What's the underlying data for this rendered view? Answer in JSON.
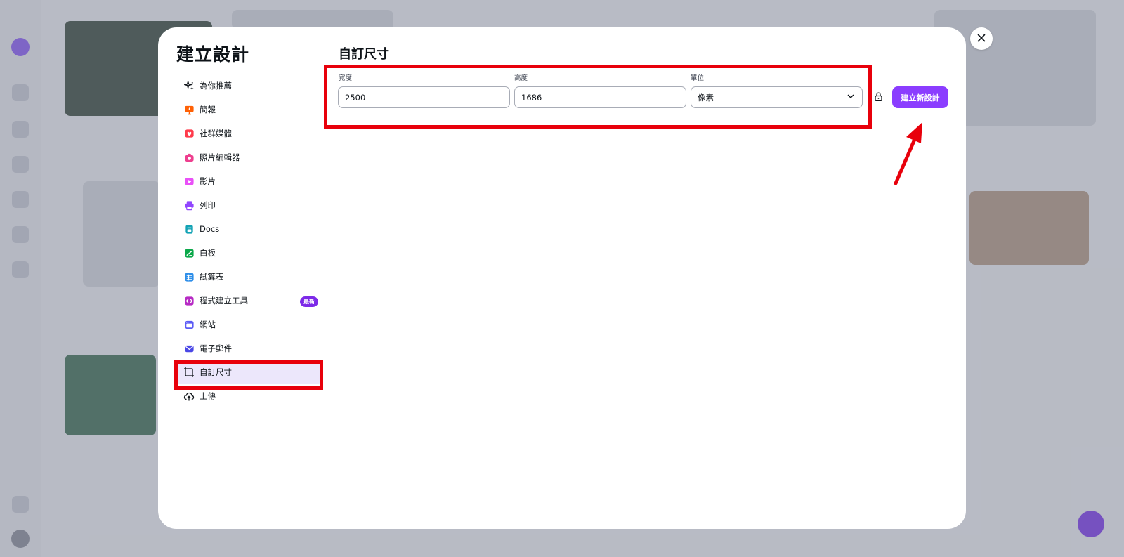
{
  "modal": {
    "title": "建立設計",
    "close_icon": "close-icon"
  },
  "menu": {
    "items": [
      {
        "label": "為你推薦",
        "icon": "sparkle-icon",
        "color": "#0e1318"
      },
      {
        "label": "簡報",
        "icon": "presentation-icon",
        "color": "#ff6105"
      },
      {
        "label": "社群媒體",
        "icon": "heart-icon",
        "color": "#ff3b4b"
      },
      {
        "label": "照片編輯器",
        "icon": "camera-icon",
        "color": "#ee3f8f"
      },
      {
        "label": "影片",
        "icon": "video-icon",
        "color": "#e950f7"
      },
      {
        "label": "列印",
        "icon": "printer-icon",
        "color": "#9146ff"
      },
      {
        "label": "Docs",
        "icon": "document-icon",
        "color": "#13a3b5"
      },
      {
        "label": "白板",
        "icon": "whiteboard-icon",
        "color": "#0ba84a"
      },
      {
        "label": "試算表",
        "icon": "spreadsheet-icon",
        "color": "#2d8ee9"
      },
      {
        "label": "程式建立工具",
        "icon": "code-icon",
        "color": "#b62ac4",
        "badge": "最新"
      },
      {
        "label": "網站",
        "icon": "website-icon",
        "color": "#5b5bf5"
      },
      {
        "label": "電子郵件",
        "icon": "email-icon",
        "color": "#4a47e6"
      },
      {
        "label": "自訂尺寸",
        "icon": "custom-size-icon",
        "color": "#0e1318",
        "active": true
      },
      {
        "label": "上傳",
        "icon": "upload-cloud-icon",
        "color": "#0e1318"
      }
    ]
  },
  "custom_size": {
    "title": "自訂尺寸",
    "width_label": "寬度",
    "width_value": "2500",
    "height_label": "高度",
    "height_value": "1686",
    "unit_label": "單位",
    "unit_value": "像素",
    "lock_icon": "lock-icon",
    "create_button": "建立新設計"
  },
  "colors": {
    "accent": "#8b3dff",
    "highlight": "#e8000b",
    "active_bg": "#ece7fb"
  }
}
